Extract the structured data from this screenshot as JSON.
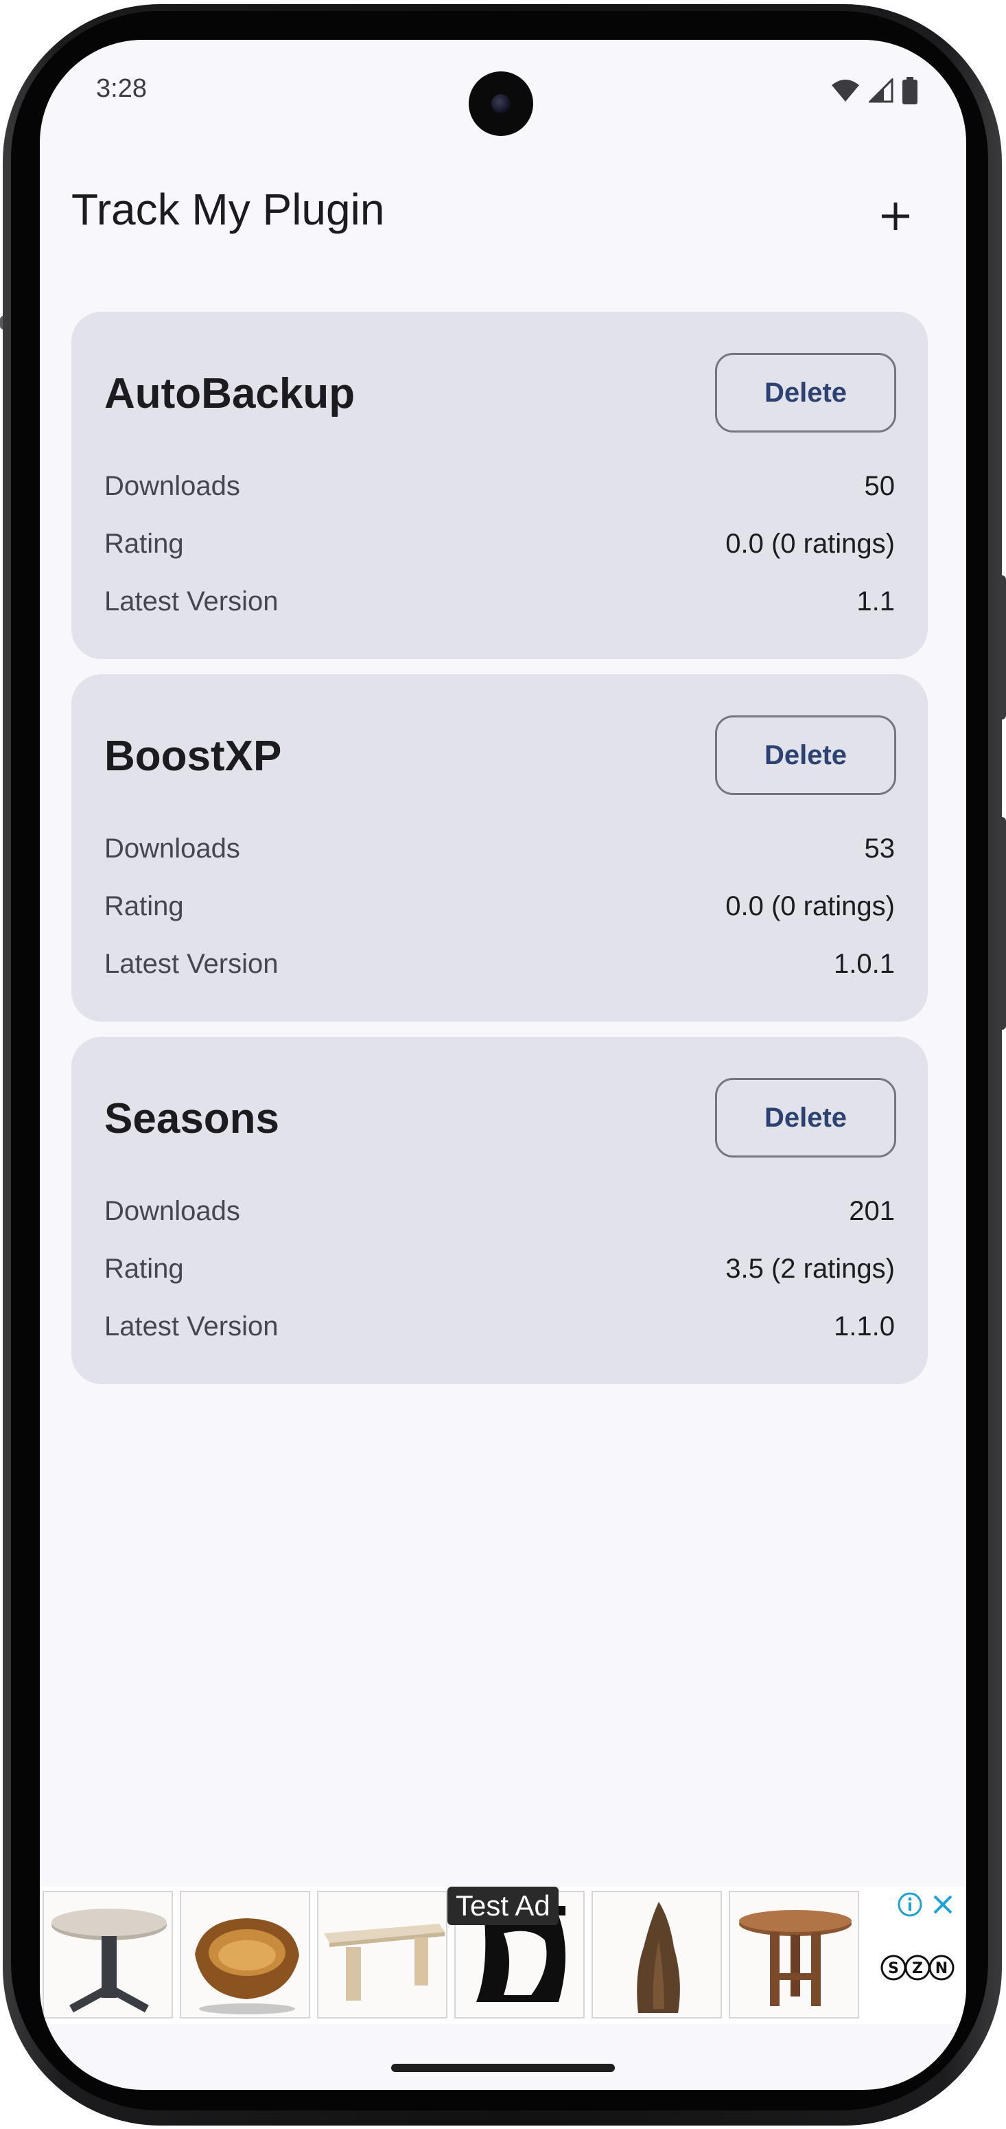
{
  "status_bar": {
    "time": "3:28",
    "icons": [
      "wifi-icon",
      "signal-icon",
      "battery-icon"
    ]
  },
  "app_bar": {
    "title": "Track My Plugin",
    "add_icon": "plus-icon"
  },
  "plugins": [
    {
      "name": "AutoBackup",
      "delete_label": "Delete",
      "downloads_label": "Downloads",
      "downloads": "50",
      "rating_label": "Rating",
      "rating": "0.0 (0 ratings)",
      "version_label": "Latest Version",
      "version": "1.1"
    },
    {
      "name": "BoostXP",
      "delete_label": "Delete",
      "downloads_label": "Downloads",
      "downloads": "53",
      "rating_label": "Rating",
      "rating": "0.0 (0 ratings)",
      "version_label": "Latest Version",
      "version": "1.0.1"
    },
    {
      "name": "Seasons",
      "delete_label": "Delete",
      "downloads_label": "Downloads",
      "downloads": "201",
      "rating_label": "Rating",
      "rating": "3.5 (2 ratings)",
      "version_label": "Latest Version",
      "version": "1.1.0"
    }
  ],
  "ad": {
    "label": "Test Ad",
    "brand": "SZN",
    "images": [
      "round-table-image",
      "wooden-sink-image",
      "bench-table-image",
      "black-side-table-image",
      "wood-slab-image",
      "wooden-stool-table-image"
    ],
    "info_icon": "info-icon",
    "close_icon": "close-icon"
  },
  "colors": {
    "background": "#f8f7fc",
    "card": "#e2e2ea",
    "primary_button_text": "#2c4372",
    "ad_choices": "#1aa3d8"
  }
}
